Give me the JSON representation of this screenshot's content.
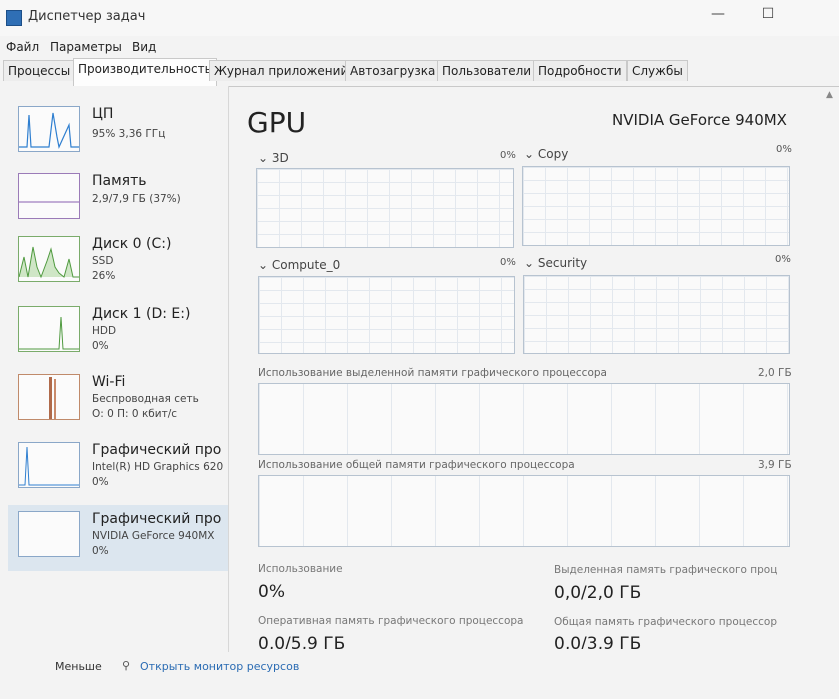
{
  "window": {
    "title": "Диспетчер задач",
    "minimize": "—",
    "maximize": "☐"
  },
  "menu": [
    "Файл",
    "Параметры",
    "Вид"
  ],
  "tabs": [
    "Процессы",
    "Производительность",
    "Журнал приложений",
    "Автозагрузка",
    "Пользователи",
    "Подробности",
    "Службы"
  ],
  "active_tab": "Производительность",
  "sidebar": {
    "items": [
      {
        "title": "ЦП",
        "line1": "95% 3,36 ГГц",
        "line2": ""
      },
      {
        "title": "Память",
        "line1": "2,9/7,9 ГБ (37%)",
        "line2": ""
      },
      {
        "title": "Диск 0 (C:)",
        "line1": "SSD",
        "line2": "26%"
      },
      {
        "title": "Диск 1 (D: E:)",
        "line1": "HDD",
        "line2": "0%"
      },
      {
        "title": "Wi-Fi",
        "line1": "Беспроводная сеть",
        "line2": "О: 0 П: 0 кбит/с"
      },
      {
        "title": "Графический про",
        "line1": "Intel(R) HD Graphics 620",
        "line2": "0%"
      },
      {
        "title": "Графический про",
        "line1": "NVIDIA GeForce 940MX",
        "line2": "0%"
      }
    ]
  },
  "main": {
    "title": "GPU",
    "gpu_name": "NVIDIA GeForce 940MX",
    "engines": [
      {
        "label": "3D",
        "value": "0%"
      },
      {
        "label": "Copy",
        "value": "0%"
      },
      {
        "label": "Compute_0",
        "value": "0%"
      },
      {
        "label": "Security",
        "value": "0%"
      }
    ],
    "dedicated_mem": {
      "label": "Использование выделенной памяти графического процессора",
      "max": "2,0 ГБ"
    },
    "shared_mem": {
      "label": "Использование общей памяти графического процессора",
      "max": "3,9 ГБ"
    },
    "stats": [
      {
        "label": "Использование",
        "value": "0%"
      },
      {
        "label": "Выделенная память графического проц",
        "value": "0,0/2,0 ГБ"
      },
      {
        "label": "Оперативная память графического процессора",
        "value": "0,0/5,9 ГБ"
      },
      {
        "label": "Общая память графического процессор",
        "value": "0,0/3,9 ГБ"
      }
    ]
  },
  "footer": {
    "fewer": "Меньше",
    "monitor": "Открыть монитор ресурсов"
  },
  "colors": {
    "accent": "#2f6fb5",
    "graph_border": "#b7c3d0",
    "cpu_line": "#2f7fd0",
    "disk_line": "#4f9a3f",
    "wifi_line": "#a0522d"
  }
}
